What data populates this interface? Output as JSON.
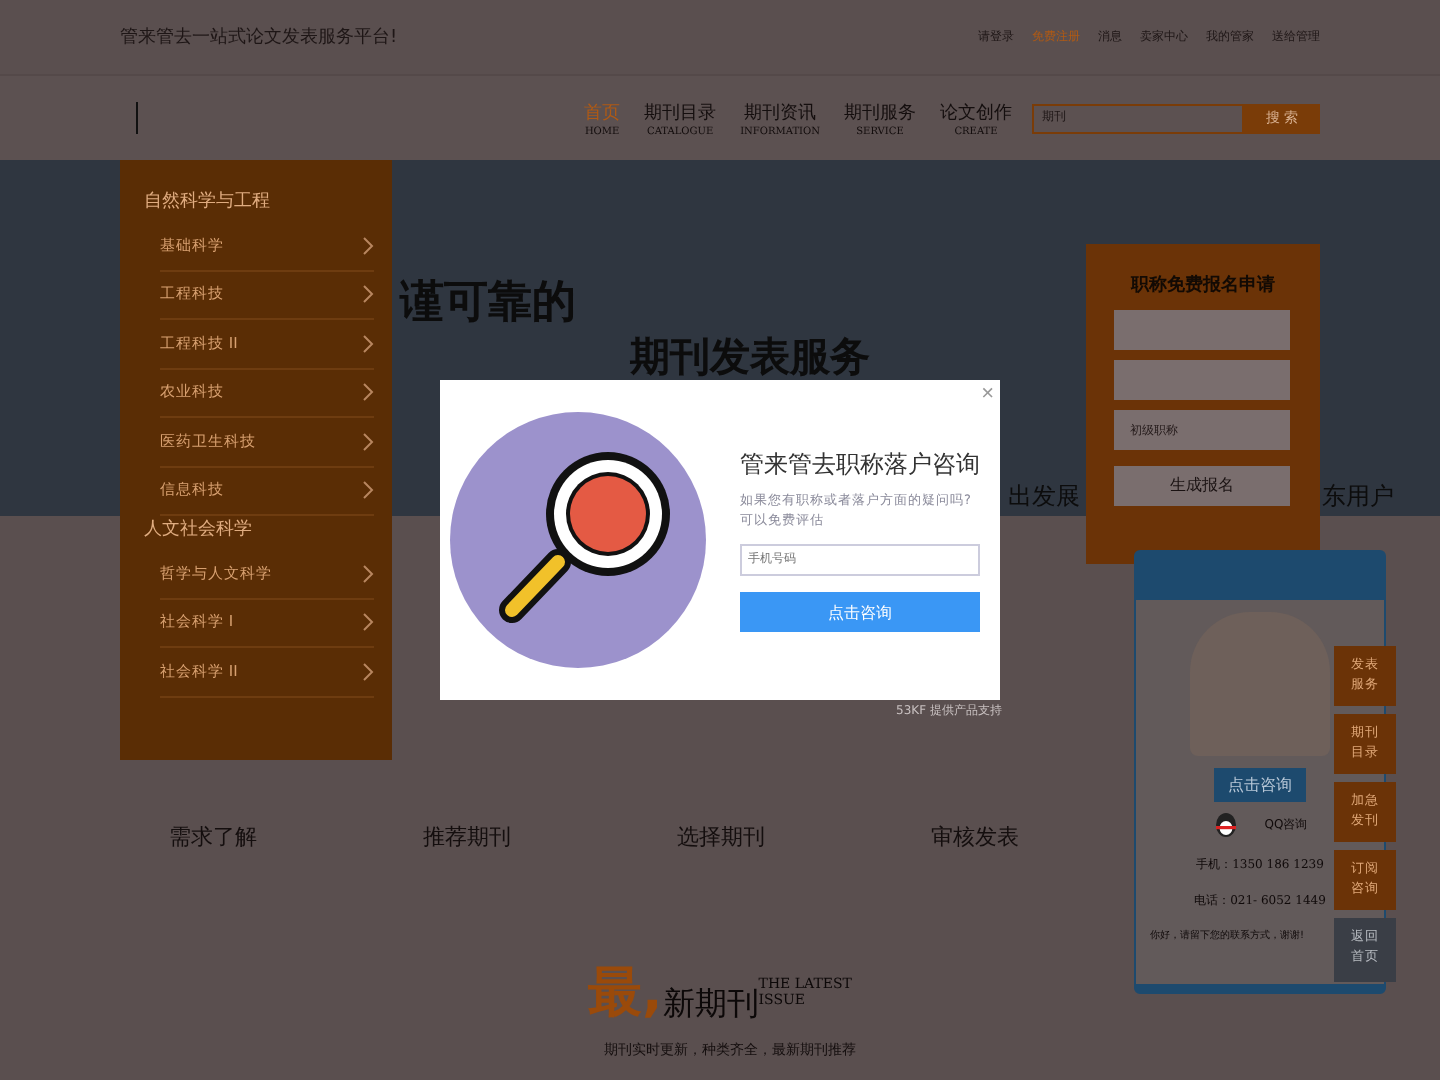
{
  "top_bar": {
    "slogan": "管来管去一站式论文发表服务平台!",
    "links": [
      {
        "label": "请登录",
        "highlight": false
      },
      {
        "label": "免费注册",
        "highlight": true
      },
      {
        "label": "消息",
        "highlight": false
      },
      {
        "label": "卖家中心",
        "highlight": false
      },
      {
        "label": "我的管家",
        "highlight": false
      },
      {
        "label": "送给管理",
        "highlight": false
      }
    ]
  },
  "nav": {
    "items": [
      {
        "label": "首页",
        "sub": "HOME",
        "selected": true
      },
      {
        "label": "期刊目录",
        "sub": "CATALOGUE",
        "selected": false
      },
      {
        "label": "期刊资讯",
        "sub": "INFORMATION",
        "selected": false
      },
      {
        "label": "期刊服务",
        "sub": "SERVICE",
        "selected": false
      },
      {
        "label": "论文创作",
        "sub": "CREATE",
        "selected": false
      }
    ],
    "search": {
      "placeholder": "期刊",
      "button": "搜 索"
    }
  },
  "sidebar": {
    "sections": [
      {
        "title": "自然科学与工程",
        "items": [
          "基础科学",
          "工程科技",
          "工程科技 II",
          "农业科技",
          "医药卫生科技",
          "信息科技"
        ]
      },
      {
        "title": "人文社会科学",
        "items": [
          "哲学与人文科学",
          "社会科学 I",
          "社会科学 II"
        ]
      }
    ]
  },
  "banner": {
    "line_1": "谨可靠的",
    "line_2": "期刊发表服务",
    "line_3_left": "出发展",
    "line_3_right": "东用户"
  },
  "signup_form": {
    "title": "职称免费报名申请",
    "fields": [
      {
        "kind": "input"
      },
      {
        "kind": "input"
      },
      {
        "kind": "select",
        "value": "初级职称"
      }
    ],
    "button": "生成报名"
  },
  "chat_widget": {
    "button": "点击咨询",
    "qq": "QQ咨询",
    "mobile": "手机：1350 186 1239",
    "phone": "电话：021- 6052 1449",
    "note": "你好，请留下您的联系方式，谢谢!"
  },
  "side_tabs": [
    {
      "label": "发表服务",
      "kind": "orange"
    },
    {
      "label": "期刊目录",
      "kind": "orange"
    },
    {
      "label": "加急发刊",
      "kind": "orange"
    },
    {
      "label": "订阅咨询",
      "kind": "orange"
    },
    {
      "label": "返回首页",
      "kind": "grey"
    }
  ],
  "steps": [
    "需求了解",
    "推荐期刊",
    "选择期刊",
    "审核发表"
  ],
  "latest": {
    "accent": "最,",
    "title": "新期刊",
    "english_1": "THE LATEST",
    "english_2": "ISSUE",
    "subtitle": "期刊实时更新，种类齐全，最新期刊推荐"
  },
  "modal": {
    "title": "管来管去职称落户咨询",
    "description": "如果您有职称或者落户方面的疑问吗?可以免费评估",
    "input_placeholder": "手机号码",
    "button": "点击咨询",
    "close": "×",
    "credit": "53KF 提供产品支持"
  }
}
